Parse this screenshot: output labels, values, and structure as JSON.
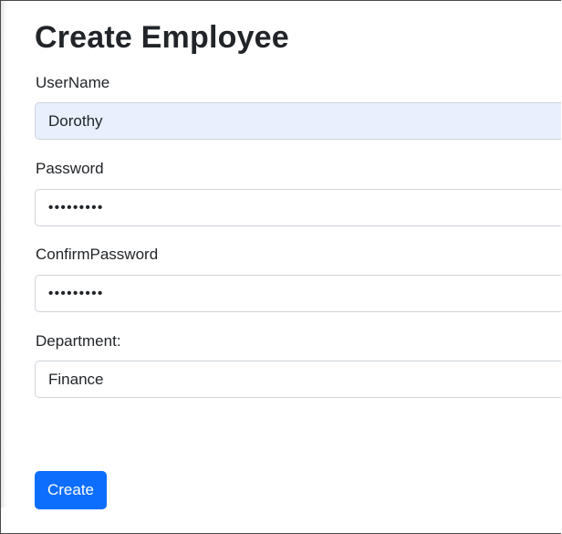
{
  "page": {
    "title": "Create Employee"
  },
  "form": {
    "username": {
      "label": "UserName",
      "value": "Dorothy"
    },
    "password": {
      "label": "Password",
      "value": "•••••••••"
    },
    "confirm_password": {
      "label": "ConfirmPassword",
      "value": "•••••••••"
    },
    "department": {
      "label": "Department:",
      "value": "Finance"
    },
    "submit_label": "Create"
  },
  "colors": {
    "primary": "#0d6efd",
    "autofill_background": "#e8f0fe",
    "input_border": "#ced4da",
    "text": "#212529"
  }
}
